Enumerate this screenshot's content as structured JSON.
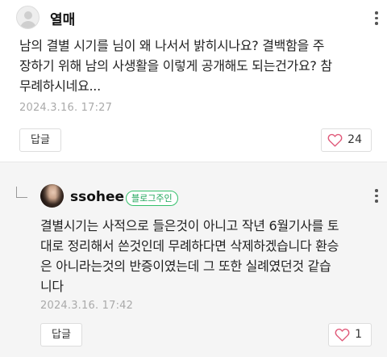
{
  "comments": [
    {
      "author": "열매",
      "text_lines": [
        "남의 결별 시기를 님이 왜 나서서 밝히시나요? 결백함을 주",
        "장하기 위해 남의 사생활을 이렇게 공개해도 되는건가요? 참",
        "무례하시네요..."
      ],
      "date": "2024.3.16.  17:27",
      "reply_label": "답글",
      "like_count": "24"
    },
    {
      "author": "ssohee",
      "badge": "블로그주인",
      "text_lines": [
        "결별시기는 사적으로 들은것이 아니고 작년 6월기사를 토",
        "대로 정리해서 쓴것인데 무례하다면 삭제하겠습니다 환승",
        "은 아니라는것의 반증이였는데 그 또한 실례였던것 같습",
        "니다"
      ],
      "date": "2024.3.16.  17:42",
      "reply_label": "답글",
      "like_count": "1"
    }
  ],
  "colors": {
    "heart": "#e05a7a",
    "badge": "#20a55a",
    "reply_background": "#f5f5f5"
  },
  "icons": [
    "default-avatar-icon",
    "more-options-icon",
    "heart-icon",
    "reply-arrow-icon"
  ]
}
